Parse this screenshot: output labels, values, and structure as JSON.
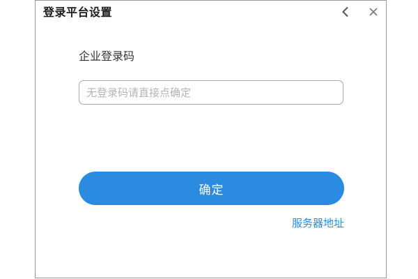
{
  "window": {
    "title": "登录平台设置",
    "back_icon": "chevron-left-icon",
    "close_icon": "close-icon"
  },
  "form": {
    "label": "企业登录码",
    "input_value": "",
    "input_placeholder": "无登录码请直接点确定",
    "confirm_label": "确定",
    "server_link": "服务器地址"
  },
  "colors": {
    "accent": "#2b8be0",
    "border": "#a8a8a8",
    "placeholder": "#b4b4b4"
  }
}
